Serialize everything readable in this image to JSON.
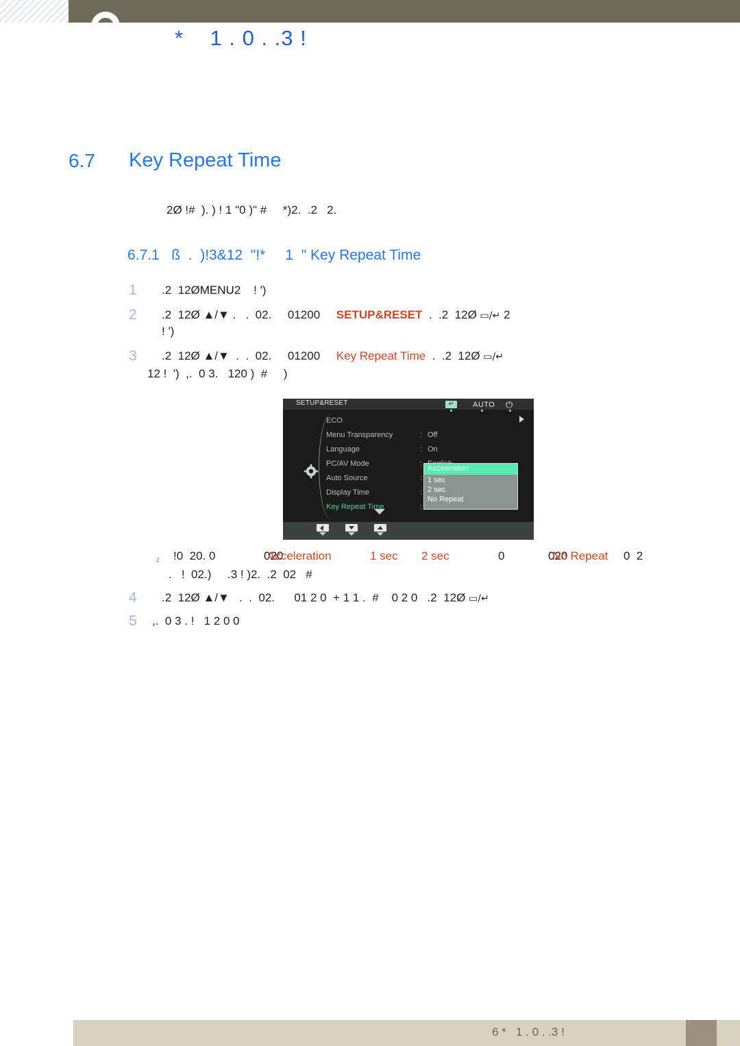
{
  "header": {
    "title": "*    1 . 0 . .3 !",
    "logo_icon": "circle-logo",
    "bar_color": "#6e6c56"
  },
  "section": {
    "number": "6.7",
    "title": "Key Repeat Time",
    "intro": "2Ø !#  ). ) ! 1 \"0 )\" #     *)2.  .2   2."
  },
  "subsection": {
    "number": "6.7.1",
    "title": "ß  .  )!3&12  \"!*     1  \" Key Repeat Time"
  },
  "steps": [
    {
      "num": "1",
      "line1_pre": ".2  12Ø",
      "line1_key": "MENU",
      "line1_post": "2    ! ')",
      "line2": ""
    },
    {
      "num": "2",
      "line1_pre": ".2  12Ø ▲/▼ .   .  02.     01200     ",
      "line1_hl": "SETUP&RESET",
      "line1_mid": "  .  .2  12Ø ",
      "line1_glyph": "▭/↵",
      "line1_post": " 2",
      "line2": "! ')"
    },
    {
      "num": "3",
      "line1_pre": ".2  12Ø ▲/▼  .  .  02.     01200     ",
      "line1_hl": "Key Repeat Time",
      "line1_mid": "  .  .2  12Ø ",
      "line1_glyph": "▭/↵",
      "line1_post": "",
      "line2": "12 !  ')  ,.  0 3.   120 )  #     )"
    },
    {
      "num": "4",
      "line1_pre": ".2  12Ø ▲/▼   .  .  02.      01 2 0  + 1 1 .  #    0 2 0   .2  12Ø ",
      "line1_hl": "",
      "line1_mid": "",
      "line1_glyph": "▭/↵",
      "line1_post": "",
      "line2": ""
    },
    {
      "num": "5",
      "line1_pre": ",.  0 3 . !   1 2 0 0",
      "line1_hl": "",
      "line1_mid": "",
      "line1_glyph": "",
      "line1_post": "",
      "line2": ""
    }
  ],
  "note": {
    "marker": "z",
    "line1_a": "!0  20. 0",
    "line1_b_black": "020",
    "line1_b_orange": "Acceleration",
    "line1_c_orange": "1 sec",
    "line1_d_orange": "2 sec",
    "line1_e": "0",
    "line1_f_black": "020",
    "line1_f_orange": "No Repeat",
    "line1_g": "0  2",
    "line2": ".   !  02.)     .3 ! )2.  .2  02   #"
  },
  "osd": {
    "title": "SETUP&RESET",
    "gear_icon": "gear-icon",
    "right_arrow_icon": "chevron-right-icon",
    "down_arrow_icon": "chevron-down-icon",
    "items": [
      {
        "label": "ECO",
        "value": "",
        "colon": "",
        "selected": false
      },
      {
        "label": "Menu Transparency",
        "value": "Off",
        "colon": ":",
        "selected": false
      },
      {
        "label": "Language",
        "value": "On",
        "colon": ":",
        "selected": false
      },
      {
        "label": "PC/AV Mode",
        "value": "English",
        "colon": ":",
        "selected": false
      },
      {
        "label": "Auto Source",
        "value": "",
        "colon": ":",
        "selected": false
      },
      {
        "label": "Display Time",
        "value": "",
        "colon": ":",
        "selected": false
      },
      {
        "label": "Key Repeat Time",
        "value": "",
        "colon": ":",
        "selected": true
      }
    ],
    "dropdown": {
      "selected": "Acceleration",
      "options": [
        "1 sec",
        "2 sec",
        "No Repeat"
      ],
      "highlight_color": "#59eab3"
    },
    "footer_buttons": [
      {
        "name": "left-button",
        "glyph": "◀"
      },
      {
        "name": "down-button",
        "glyph": "▼"
      },
      {
        "name": "up-button",
        "glyph": "▲"
      },
      {
        "name": "enter-button",
        "glyph": "↵"
      },
      {
        "name": "auto-button",
        "glyph": "AUTO"
      },
      {
        "name": "power-button",
        "glyph": "⏻"
      }
    ]
  },
  "footer": {
    "text": "6 *   1 . 0 . .3 !"
  }
}
